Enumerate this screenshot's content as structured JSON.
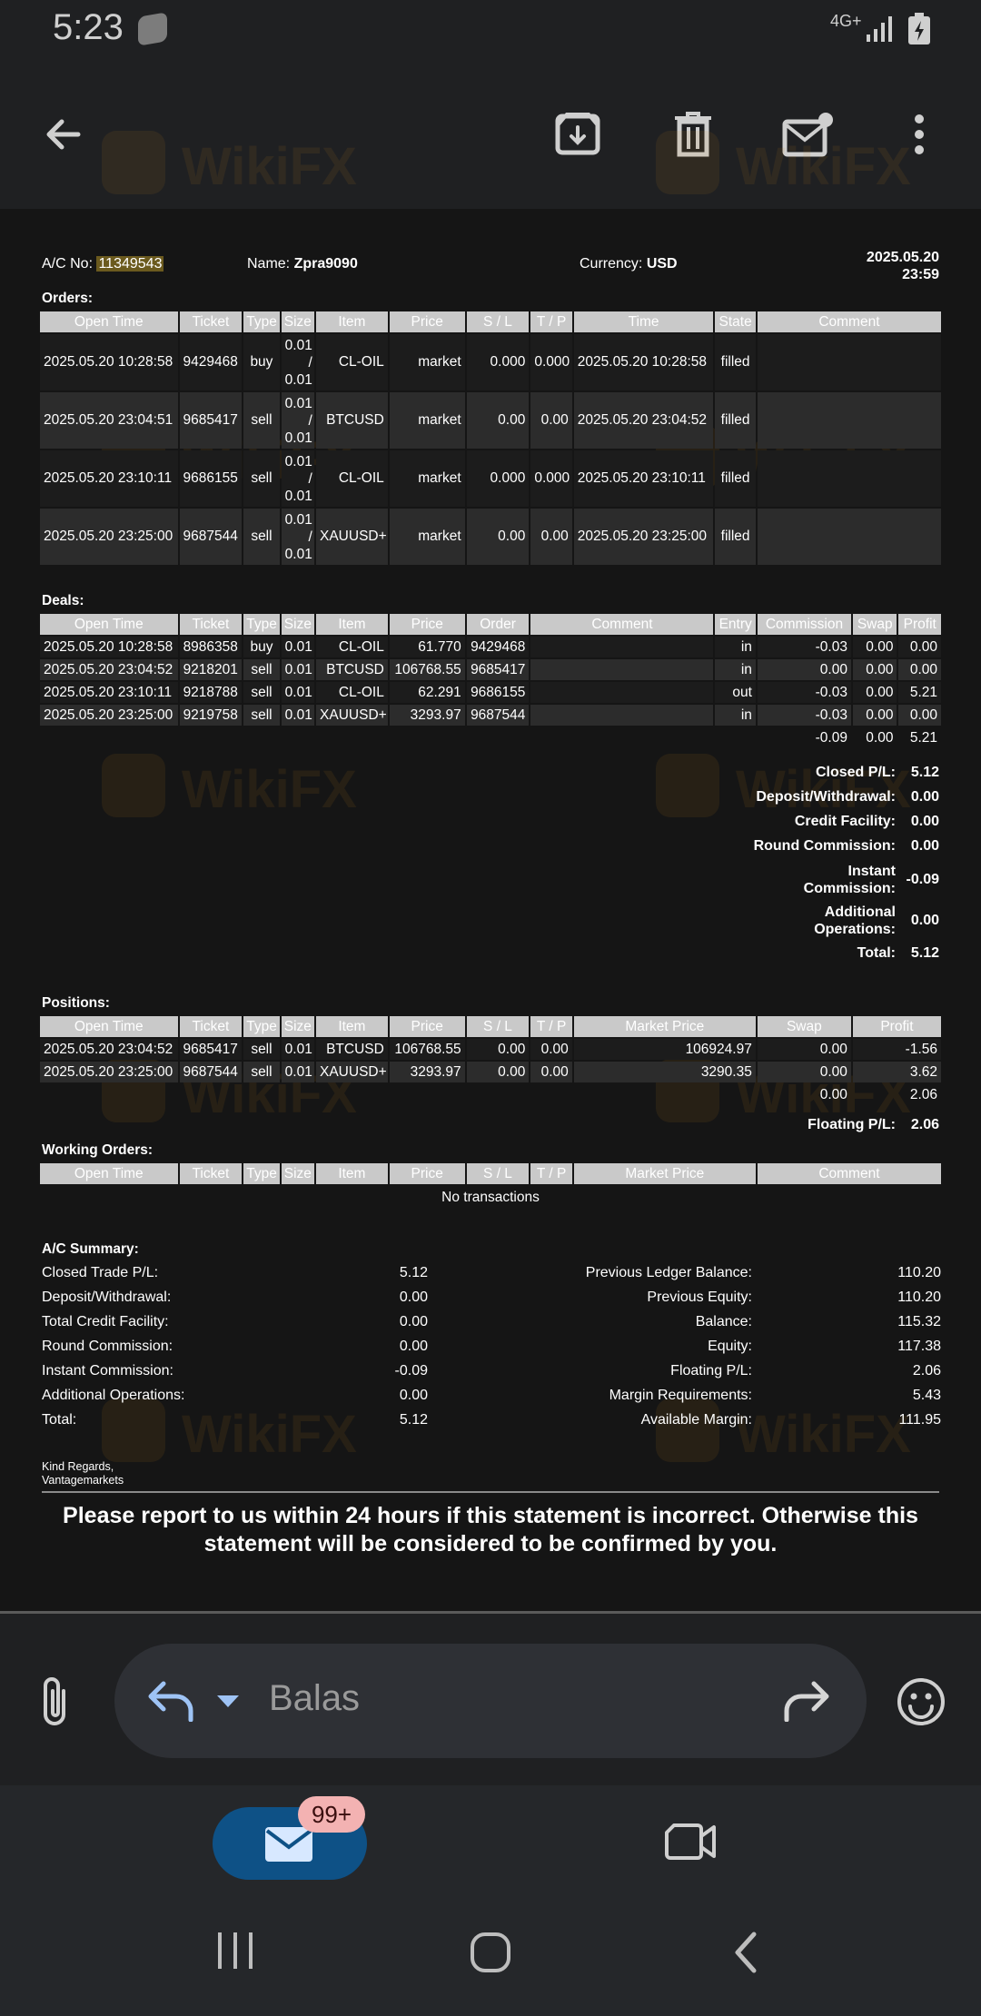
{
  "status_bar": {
    "time": "5:23",
    "network": "4G+"
  },
  "toolbar": {
    "back_icon": "arrow-left-icon",
    "archive_icon": "archive-icon",
    "delete_icon": "trash-icon",
    "unread_icon": "mail-unread-icon",
    "more_icon": "more-vert-icon"
  },
  "statement": {
    "header": {
      "ac_label": "A/C No:",
      "ac_number": "11349543",
      "name_label": "Name:",
      "name_value": "Zpra9090",
      "currency_label": "Currency:",
      "currency_value": "USD",
      "date": "2025.05.20",
      "time": "23:59"
    },
    "orders": {
      "label": "Orders:",
      "columns": [
        "Open Time",
        "Ticket",
        "Type",
        "Size",
        "Item",
        "Price",
        "S / L",
        "T / P",
        "Time",
        "State",
        "Comment"
      ],
      "rows": [
        {
          "open": "2025.05.20 10:28:58",
          "ticket": "9429468",
          "type": "buy",
          "size_a": "0.01",
          "size_sep": "/",
          "size_b": "0.01",
          "item": "CL-OIL",
          "price": "market",
          "sl": "0.000",
          "tp": "0.000",
          "time": "2025.05.20 10:28:58",
          "state": "filled",
          "comment": ""
        },
        {
          "open": "2025.05.20 23:04:51",
          "ticket": "9685417",
          "type": "sell",
          "size_a": "0.01",
          "size_sep": "/",
          "size_b": "0.01",
          "item": "BTCUSD",
          "price": "market",
          "sl": "0.00",
          "tp": "0.00",
          "time": "2025.05.20 23:04:52",
          "state": "filled",
          "comment": ""
        },
        {
          "open": "2025.05.20 23:10:11",
          "ticket": "9686155",
          "type": "sell",
          "size_a": "0.01",
          "size_sep": "/",
          "size_b": "0.01",
          "item": "CL-OIL",
          "price": "market",
          "sl": "0.000",
          "tp": "0.000",
          "time": "2025.05.20 23:10:11",
          "state": "filled",
          "comment": ""
        },
        {
          "open": "2025.05.20 23:25:00",
          "ticket": "9687544",
          "type": "sell",
          "size_a": "0.01",
          "size_sep": "/",
          "size_b": "0.01",
          "item": "XAUUSD+",
          "price": "market",
          "sl": "0.00",
          "tp": "0.00",
          "time": "2025.05.20 23:25:00",
          "state": "filled",
          "comment": ""
        }
      ]
    },
    "deals": {
      "label": "Deals:",
      "columns": [
        "Open Time",
        "Ticket",
        "Type",
        "Size",
        "Item",
        "Price",
        "Order",
        "Comment",
        "Entry",
        "Commission",
        "Swap",
        "Profit"
      ],
      "rows": [
        {
          "open": "2025.05.20 10:28:58",
          "ticket": "8986358",
          "type": "buy",
          "size": "0.01",
          "item": "CL-OIL",
          "price": "61.770",
          "order": "9429468",
          "comment": "",
          "entry": "in",
          "commission": "-0.03",
          "swap": "0.00",
          "profit": "0.00"
        },
        {
          "open": "2025.05.20 23:04:52",
          "ticket": "9218201",
          "type": "sell",
          "size": "0.01",
          "item": "BTCUSD",
          "price": "106768.55",
          "order": "9685417",
          "comment": "",
          "entry": "in",
          "commission": "0.00",
          "swap": "0.00",
          "profit": "0.00"
        },
        {
          "open": "2025.05.20 23:10:11",
          "ticket": "9218788",
          "type": "sell",
          "size": "0.01",
          "item": "CL-OIL",
          "price": "62.291",
          "order": "9686155",
          "comment": "",
          "entry": "out",
          "commission": "-0.03",
          "swap": "0.00",
          "profit": "5.21"
        },
        {
          "open": "2025.05.20 23:25:00",
          "ticket": "9219758",
          "type": "sell",
          "size": "0.01",
          "item": "XAUUSD+",
          "price": "3293.97",
          "order": "9687544",
          "comment": "",
          "entry": "in",
          "commission": "-0.03",
          "swap": "0.00",
          "profit": "0.00"
        }
      ],
      "totals": {
        "commission": "-0.09",
        "swap": "0.00",
        "profit": "5.21"
      },
      "summary": [
        {
          "label": "Closed P/L:",
          "value": "5.12"
        },
        {
          "label": "Deposit/Withdrawal:",
          "value": "0.00"
        },
        {
          "label": "Credit Facility:",
          "value": "0.00"
        },
        {
          "label": "Round Commission:",
          "value": "0.00"
        },
        {
          "label_1": "Instant",
          "label_2": "Commission:",
          "value": "-0.09"
        },
        {
          "label_1": "Additional",
          "label_2": "Operations:",
          "value": "0.00"
        },
        {
          "label": "Total:",
          "value": "5.12"
        }
      ]
    },
    "positions": {
      "label": "Positions:",
      "columns": [
        "Open Time",
        "Ticket",
        "Type",
        "Size",
        "Item",
        "Price",
        "S / L",
        "T / P",
        "Market Price",
        "Swap",
        "Profit"
      ],
      "rows": [
        {
          "open": "2025.05.20 23:04:52",
          "ticket": "9685417",
          "type": "sell",
          "size": "0.01",
          "item": "BTCUSD",
          "price": "106768.55",
          "sl": "0.00",
          "tp": "0.00",
          "market": "106924.97",
          "swap": "0.00",
          "profit": "-1.56"
        },
        {
          "open": "2025.05.20 23:25:00",
          "ticket": "9687544",
          "type": "sell",
          "size": "0.01",
          "item": "XAUUSD+",
          "price": "3293.97",
          "sl": "0.00",
          "tp": "0.00",
          "market": "3290.35",
          "swap": "0.00",
          "profit": "3.62"
        }
      ],
      "totals": {
        "swap": "0.00",
        "profit": "2.06"
      },
      "floating_label": "Floating P/L:",
      "floating_value": "2.06"
    },
    "working_orders": {
      "label": "Working Orders:",
      "columns": [
        "Open Time",
        "Ticket",
        "Type",
        "Size",
        "Item",
        "Price",
        "S / L",
        "T / P",
        "Market Price",
        "Comment"
      ],
      "empty": "No transactions"
    },
    "ac_summary": {
      "label": "A/C Summary:",
      "left": [
        {
          "label": "Closed Trade P/L:",
          "value": "5.12"
        },
        {
          "label": "Deposit/Withdrawal:",
          "value": "0.00"
        },
        {
          "label": "Total Credit Facility:",
          "value": "0.00"
        },
        {
          "label": "Round Commission:",
          "value": "0.00"
        },
        {
          "label": "Instant Commission:",
          "value": "-0.09"
        },
        {
          "label": "Additional Operations:",
          "value": "0.00"
        },
        {
          "label": "Total:",
          "value": "5.12"
        }
      ],
      "right": [
        {
          "label": "Previous Ledger Balance:",
          "value": "110.20"
        },
        {
          "label": "Previous Equity:",
          "value": "110.20"
        },
        {
          "label": "Balance:",
          "value": "115.32"
        },
        {
          "label": "Equity:",
          "value": "117.38"
        },
        {
          "label": "Floating P/L:",
          "value": "2.06"
        },
        {
          "label": "Margin Requirements:",
          "value": "5.43"
        },
        {
          "label": "Available Margin:",
          "value": "111.95"
        }
      ]
    },
    "regards_1": "Kind Regards,",
    "regards_2": "Vantagemarkets",
    "warning": "Please report to us within 24 hours if this statement is incorrect. Otherwise this statement will be considered to be confirmed by you."
  },
  "reply_bar": {
    "placeholder": "Balas",
    "attach_icon": "paperclip-icon",
    "reply_icon": "reply-icon",
    "dropdown_icon": "caret-down-icon",
    "forward_icon": "forward-icon",
    "emoji_icon": "emoji-icon"
  },
  "bottom_nav": {
    "mail_badge": "99+",
    "mail_icon": "mail-icon",
    "meet_icon": "video-icon"
  },
  "watermark": "WikiFX",
  "colors": {
    "background": "#151515",
    "header_cell": "#c9c9c9",
    "row_alt": "#2c2c2c",
    "highlight": "#6b5a1e",
    "mail_pill": "#0e5186",
    "badge": "#f3b2b2"
  }
}
